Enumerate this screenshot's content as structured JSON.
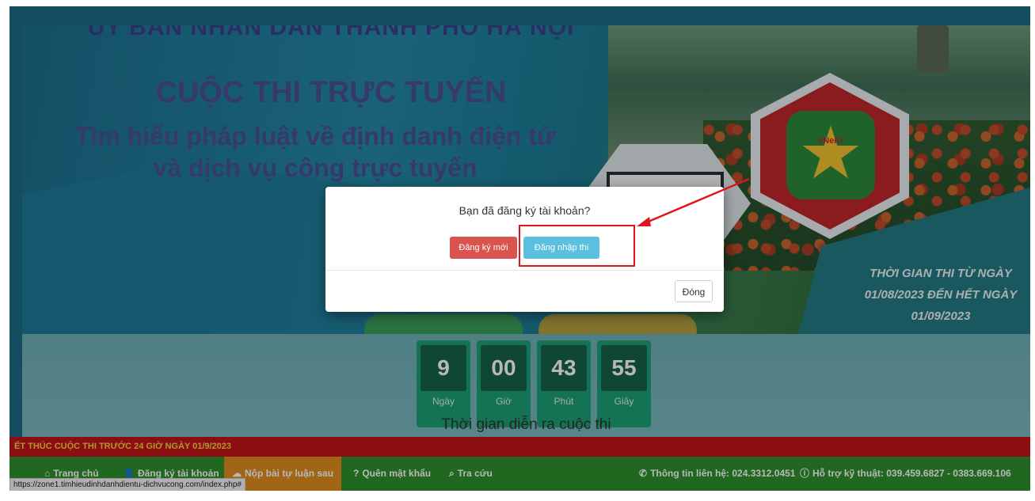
{
  "banner": {
    "title_top": "ỦY BAN NHÂN DÂN THÀNH PHỐ HÀ NỘI",
    "title_main": "CUỘC THI TRỰC TUYẾN",
    "title_sub_line1": "Tìm hiểu pháp luật về định danh điện tử",
    "title_sub_line2": "và dịch vụ công trực tuyến",
    "badge_text": "VNeID",
    "exam_time_line1": "THỜI GIAN THI TỪ NGÀY",
    "exam_time_line2": "01/08/2023 ĐẾN HẾT NGÀY",
    "exam_time_line3": "01/09/2023"
  },
  "countdown": {
    "items": [
      {
        "value": "9",
        "label": "Ngày"
      },
      {
        "value": "00",
        "label": "Giờ"
      },
      {
        "value": "43",
        "label": "Phút"
      },
      {
        "value": "55",
        "label": "Giây"
      }
    ],
    "caption": "Thời gian diễn ra cuộc thi"
  },
  "notice": "ẾT THÚC CUỘC THI TRƯỚC 24 GIỜ NGÀY 01/9/2023",
  "nav": {
    "home": "Trang chủ",
    "register": "Đăng ký tài khoản",
    "submit": "Nộp bài tự luận sau",
    "forgot": "Quên mật khẩu",
    "lookup": "Tra cứu",
    "contact": "Thông tin liên hệ: 024.3312.0451",
    "support": "Hỗ trợ kỹ thuật: 039.459.6827 - 0383.669.106"
  },
  "status_url": "https://zone1.timhieudinhdanhdientu-dichvucong.com/index.php#",
  "modal": {
    "question": "Bạn đã đăng ký tài khoản?",
    "register_label": "Đăng ký mới",
    "login_label": "Đăng nhập thi",
    "close_label": "Đóng"
  },
  "colors": {
    "register_button": "#d9534f",
    "login_button": "#5bc0de",
    "nav_bar": "#2f8f2c",
    "nav_active": "#e08c1f",
    "notice_bar": "#c3121a",
    "highlight": "#e0141b"
  }
}
